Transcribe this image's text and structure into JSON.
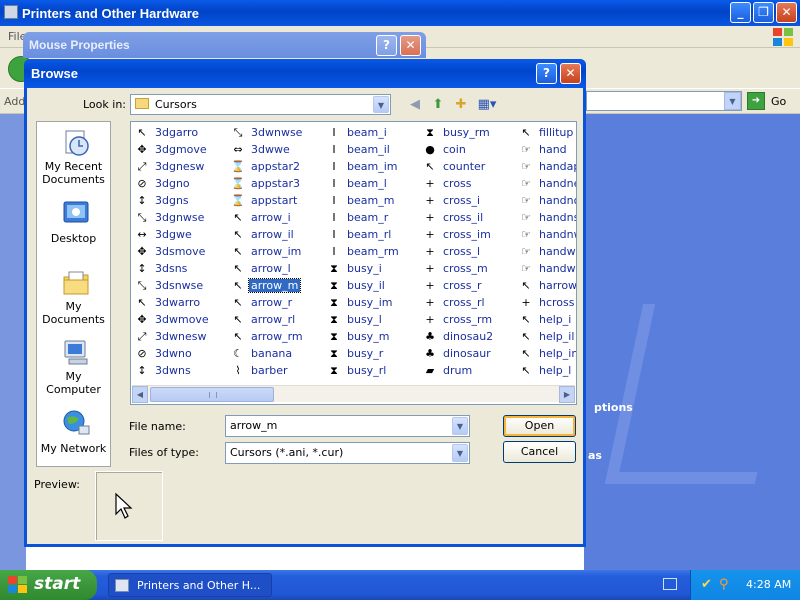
{
  "background_window": {
    "title": "Printers and Other Hardware",
    "menu_first": "File",
    "address_label": "Address",
    "go_label": "Go",
    "content_partial_1": "ptions",
    "content_partial_2": "as"
  },
  "mouse_properties": {
    "title": "Mouse Properties",
    "help_glyph": "?",
    "close_glyph": "✕"
  },
  "browse": {
    "title": "Browse",
    "help_glyph": "?",
    "close_glyph": "✕",
    "look_in_label": "Look in:",
    "look_in_value": "Cursors",
    "places": [
      {
        "label": "My Recent Documents"
      },
      {
        "label": "Desktop"
      },
      {
        "label": "My Documents"
      },
      {
        "label": "My Computer"
      },
      {
        "label": "My Network"
      }
    ],
    "file_columns": [
      [
        {
          "name": "3dgarro",
          "icon": "↖"
        },
        {
          "name": "3dgmove",
          "icon": "✥"
        },
        {
          "name": "3dgnesw",
          "icon": "⤢"
        },
        {
          "name": "3dgno",
          "icon": "⊘"
        },
        {
          "name": "3dgns",
          "icon": "↕"
        },
        {
          "name": "3dgnwse",
          "icon": "⤡"
        },
        {
          "name": "3dgwe",
          "icon": "↔"
        },
        {
          "name": "3dsmove",
          "icon": "✥"
        },
        {
          "name": "3dsns",
          "icon": "↕"
        },
        {
          "name": "3dsnwse",
          "icon": "⤡"
        },
        {
          "name": "3dwarro",
          "icon": "↖"
        },
        {
          "name": "3dwmove",
          "icon": "✥"
        },
        {
          "name": "3dwnesw",
          "icon": "⤢"
        },
        {
          "name": "3dwno",
          "icon": "⊘"
        },
        {
          "name": "3dwns",
          "icon": "↕"
        }
      ],
      [
        {
          "name": "3dwnwse",
          "icon": "⤡"
        },
        {
          "name": "3dwwe",
          "icon": "⇔"
        },
        {
          "name": "appstar2",
          "icon": "⌛"
        },
        {
          "name": "appstar3",
          "icon": "⌛"
        },
        {
          "name": "appstart",
          "icon": "⌛"
        },
        {
          "name": "arrow_i",
          "icon": "↖"
        },
        {
          "name": "arrow_il",
          "icon": "↖"
        },
        {
          "name": "arrow_im",
          "icon": "↖"
        },
        {
          "name": "arrow_l",
          "icon": "↖"
        },
        {
          "name": "arrow_m",
          "icon": "↖",
          "selected": true
        },
        {
          "name": "arrow_r",
          "icon": "↖"
        },
        {
          "name": "arrow_rl",
          "icon": "↖"
        },
        {
          "name": "arrow_rm",
          "icon": "↖"
        },
        {
          "name": "banana",
          "icon": "☾"
        },
        {
          "name": "barber",
          "icon": "⌇"
        }
      ],
      [
        {
          "name": "beam_i",
          "icon": "I"
        },
        {
          "name": "beam_il",
          "icon": "I"
        },
        {
          "name": "beam_im",
          "icon": "I"
        },
        {
          "name": "beam_l",
          "icon": "I"
        },
        {
          "name": "beam_m",
          "icon": "I"
        },
        {
          "name": "beam_r",
          "icon": "I"
        },
        {
          "name": "beam_rl",
          "icon": "I"
        },
        {
          "name": "beam_rm",
          "icon": "I"
        },
        {
          "name": "busy_i",
          "icon": "⧗"
        },
        {
          "name": "busy_il",
          "icon": "⧗"
        },
        {
          "name": "busy_im",
          "icon": "⧗"
        },
        {
          "name": "busy_l",
          "icon": "⧗"
        },
        {
          "name": "busy_m",
          "icon": "⧗"
        },
        {
          "name": "busy_r",
          "icon": "⧗"
        },
        {
          "name": "busy_rl",
          "icon": "⧗"
        }
      ],
      [
        {
          "name": "busy_rm",
          "icon": "⧗"
        },
        {
          "name": "coin",
          "icon": "●"
        },
        {
          "name": "counter",
          "icon": "↖"
        },
        {
          "name": "cross",
          "icon": "+"
        },
        {
          "name": "cross_i",
          "icon": "+"
        },
        {
          "name": "cross_il",
          "icon": "+"
        },
        {
          "name": "cross_im",
          "icon": "+"
        },
        {
          "name": "cross_l",
          "icon": "+"
        },
        {
          "name": "cross_m",
          "icon": "+"
        },
        {
          "name": "cross_r",
          "icon": "+"
        },
        {
          "name": "cross_rl",
          "icon": "+"
        },
        {
          "name": "cross_rm",
          "icon": "+"
        },
        {
          "name": "dinosau2",
          "icon": "♣"
        },
        {
          "name": "dinosaur",
          "icon": "♣"
        },
        {
          "name": "drum",
          "icon": "▰"
        }
      ],
      [
        {
          "name": "fillitup",
          "icon": "↖"
        },
        {
          "name": "hand",
          "icon": "☞"
        },
        {
          "name": "handapst",
          "icon": "☞"
        },
        {
          "name": "handnesw",
          "icon": "☞"
        },
        {
          "name": "handno",
          "icon": "☞"
        },
        {
          "name": "handns",
          "icon": "☞"
        },
        {
          "name": "handnwse",
          "icon": "☞"
        },
        {
          "name": "handwait",
          "icon": "☞"
        },
        {
          "name": "handwe",
          "icon": "☞"
        },
        {
          "name": "harrow",
          "icon": "↖"
        },
        {
          "name": "hcross",
          "icon": "+"
        },
        {
          "name": "help_i",
          "icon": "↖"
        },
        {
          "name": "help_il",
          "icon": "↖"
        },
        {
          "name": "help_im",
          "icon": "↖"
        },
        {
          "name": "help_l",
          "icon": "↖"
        }
      ]
    ],
    "file_name_label": "File name:",
    "file_name_value": "arrow_m",
    "files_of_type_label": "Files of type:",
    "files_of_type_value": "Cursors (*.ani, *.cur)",
    "open_label": "Open",
    "cancel_label": "Cancel",
    "preview_label": "Preview:"
  },
  "taskbar": {
    "start_label": "start",
    "task_label": "Printers and Other H...",
    "clock": "4:28 AM"
  },
  "colors": {
    "title_blue": "#0a52d8",
    "selection": "#316ac5",
    "taskbar_blue": "#245edb",
    "start_green": "#3c963c"
  }
}
